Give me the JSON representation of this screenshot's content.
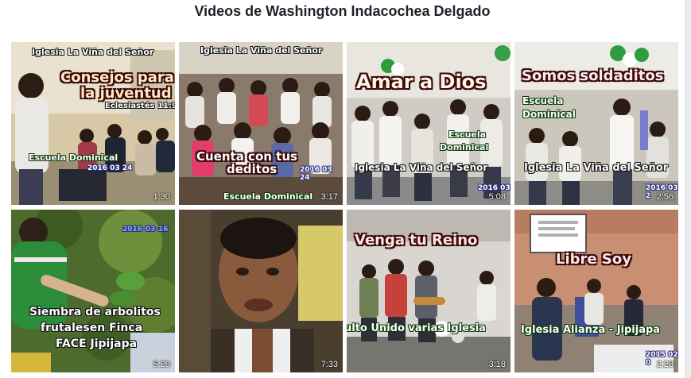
{
  "page": {
    "title": "Videos de Washington Indacochea Delgado"
  },
  "videos": [
    {
      "duration": "1:30",
      "stamp": "2016 03 24",
      "lines": [
        "Iglesia La Viña del Señor",
        "Consejos para",
        "la juventud",
        "Eclesiastés 11:9",
        "Escuela Dominical"
      ]
    },
    {
      "duration": "3:17",
      "stamp": "2016 03 24",
      "lines": [
        "Iglesia La Viña del Señor",
        "Cuenta con tus",
        "deditos",
        "Escuela Dominical"
      ]
    },
    {
      "duration": "5:08",
      "stamp": "2016 03",
      "lines": [
        "Amar a Dios",
        "Escuela",
        "Dominical",
        "Iglesia La Viña del Señor"
      ]
    },
    {
      "duration": "2:56",
      "stamp": "2016 03 2",
      "lines": [
        "Somos soldaditos",
        "Escuela",
        "Dominical",
        "Iglesia La Viña del Señor"
      ]
    },
    {
      "duration": "5:20",
      "stamp": "2016-03-16",
      "lines": [
        "Siembra de arbolitos",
        "frutalesen Finca",
        "FACE Jipijapa"
      ]
    },
    {
      "duration": "7:33",
      "stamp": "",
      "lines": []
    },
    {
      "duration": "3:18",
      "stamp": "",
      "lines": [
        "Venga tu Reino",
        "ulto Unido varias Iglesia"
      ]
    },
    {
      "duration": "2:28",
      "stamp": "2015 02 0",
      "lines": [
        "Libre Soy",
        "Iglesia Alianza - Jipijapa"
      ]
    }
  ]
}
